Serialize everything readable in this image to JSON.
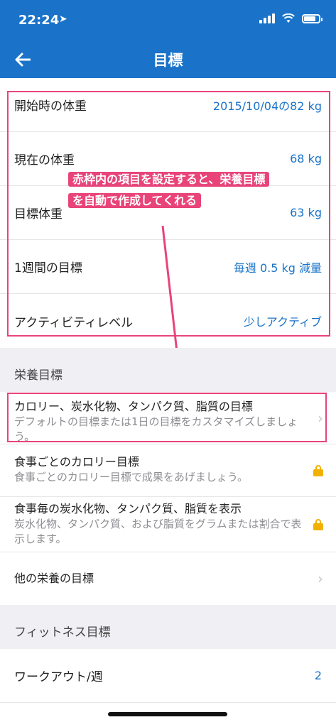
{
  "status": {
    "time": "22:24",
    "battery_level": 0.8
  },
  "nav": {
    "title": "目標",
    "back_icon": "arrow-left-icon"
  },
  "weight_rows": [
    {
      "label": "開始時の体重",
      "value": "2015/10/04の82 kg"
    },
    {
      "label": "現在の体重",
      "value": "68 kg"
    },
    {
      "label": "目標体重",
      "value": "63 kg"
    },
    {
      "label": "1週間の目標",
      "value": "毎週 0.5 kg 減量"
    },
    {
      "label": "アクティビティレベル",
      "value": "少しアクティブ"
    }
  ],
  "annotation": {
    "line1": "赤枠内の項目を設定すると、栄養目標",
    "line2": "を自動で作成してくれる",
    "color": "#e8447a"
  },
  "nutrition": {
    "header": "栄養目標",
    "rows": [
      {
        "title": "カロリー、炭水化物、タンパク質、脂質の目標",
        "desc": "デフォルトの目標または1日の目標をカスタマイズしましょう。",
        "icon": "chevron-right-icon"
      },
      {
        "title": "食事ごとのカロリー目標",
        "desc": "食事ごとのカロリー目標で成果をあげましょう。",
        "icon": "lock-icon"
      },
      {
        "title": "食事毎の炭水化物、タンパク質、脂質を表示",
        "desc": "炭水化物、タンパク質、および脂質をグラムまたは割合で表示します。",
        "icon": "lock-icon"
      },
      {
        "title": "他の栄養の目標",
        "desc": "",
        "icon": "chevron-right-icon"
      }
    ]
  },
  "fitness": {
    "header": "フィットネス目標",
    "rows": [
      {
        "label": "ワークアウト/週",
        "value": "2"
      }
    ]
  },
  "colors": {
    "brand": "#1a73c9",
    "accent_lock": "#f2b100"
  }
}
